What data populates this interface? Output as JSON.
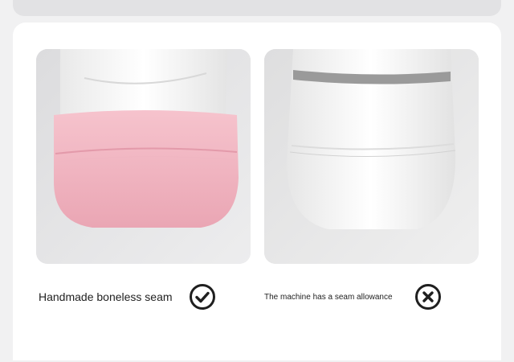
{
  "comparison": {
    "left": {
      "caption": "Handmade boneless seam",
      "status_icon": "check-circle-icon",
      "sock_color": "#f4bfca"
    },
    "right": {
      "caption": "The machine has a seam allowance",
      "status_icon": "cross-circle-icon",
      "stripe_color": "#9a9a9a"
    }
  }
}
